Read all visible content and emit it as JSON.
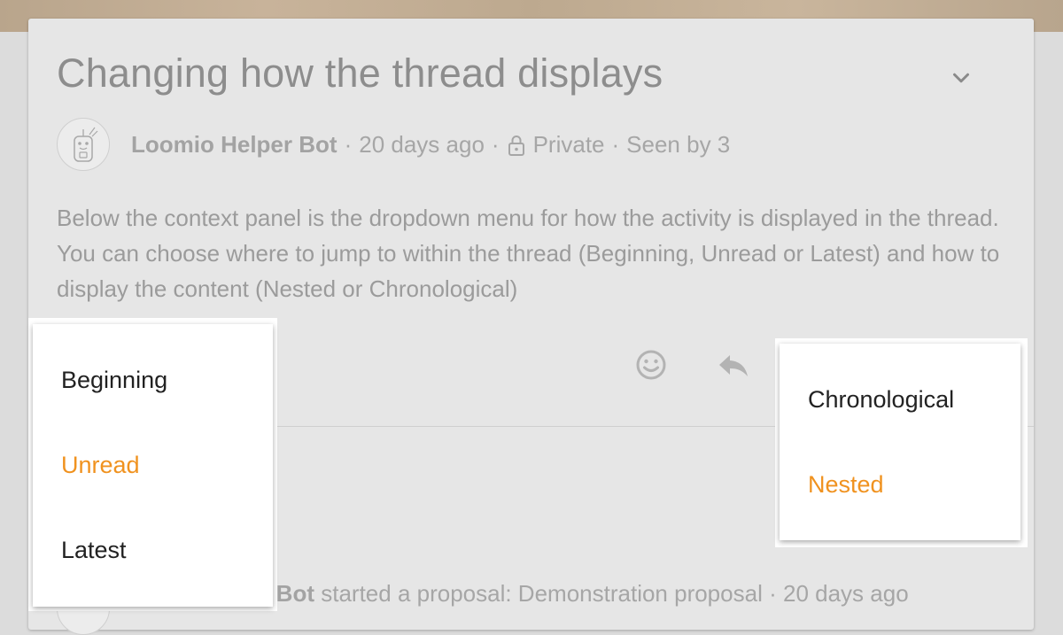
{
  "thread": {
    "title": "Changing how the thread displays",
    "author": "Loomio Helper Bot",
    "time": "20 days ago",
    "privacy": "Private",
    "seen": "Seen by 3",
    "separator": "·",
    "body": "Below the context panel is the dropdown menu for how the activity is displayed in the thread. You can choose where to jump to within the thread (Beginning, Unread or Latest) and how to display the content (Nested or Chronological)"
  },
  "event": {
    "author_visible": "per Bot",
    "action": "started a proposal: Demonstration proposal",
    "separator": "·",
    "time": "20 days ago"
  },
  "jump_menu": {
    "items": [
      {
        "label": "Beginning",
        "active": false
      },
      {
        "label": "Unread",
        "active": true
      },
      {
        "label": "Latest",
        "active": false
      }
    ]
  },
  "order_menu": {
    "items": [
      {
        "label": "Chronological",
        "active": false
      },
      {
        "label": "Nested",
        "active": true
      }
    ]
  },
  "colors": {
    "accent": "#f0921f",
    "muted_text": "#9b9b9b",
    "card_background": "#e6e6e6"
  },
  "icons": [
    "chevron-down-icon",
    "lock-icon",
    "emoji-icon",
    "reply-icon",
    "bot-avatar"
  ]
}
